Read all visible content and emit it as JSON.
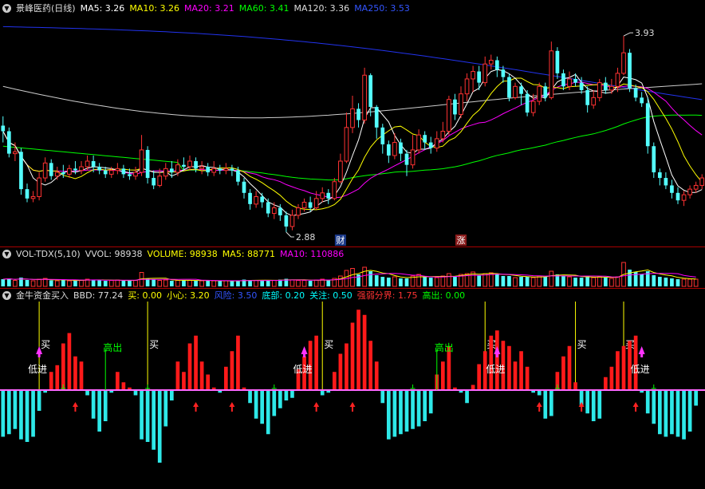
{
  "price_panel": {
    "title": "景峰医药(日线)",
    "ma_items": [
      {
        "text": "MA5: 3.26",
        "color": "#ffffff"
      },
      {
        "text": "MA10: 3.26",
        "color": "#ffff00"
      },
      {
        "text": "MA20: 3.21",
        "color": "#ff00ff"
      },
      {
        "text": "MA60: 3.41",
        "color": "#00ff00"
      },
      {
        "text": "MA120: 3.36",
        "color": "#dddddd"
      },
      {
        "text": "MA250: 3.53",
        "color": "#3355ff"
      }
    ],
    "high_label": "3.93",
    "low_label": "2.88",
    "badge_cai": "财",
    "badge_zhang": "涨"
  },
  "volume_panel": {
    "items": [
      {
        "text": "VOL-TDX(5,10)",
        "color": "#dddddd"
      },
      {
        "text": "VVOL: 98938",
        "color": "#dddddd"
      },
      {
        "text": "VOLUME: 98938",
        "color": "#ffff00"
      },
      {
        "text": "MA5: 88771",
        "color": "#ffff00"
      },
      {
        "text": "MA10: 110886",
        "color": "#ff00ff"
      }
    ]
  },
  "indicator_panel": {
    "items": [
      {
        "text": "金牛资金买入",
        "color": "#dddddd"
      },
      {
        "text": "BBD: 77.24",
        "color": "#dddddd"
      },
      {
        "text": "买: 0.00",
        "color": "#ffff00"
      },
      {
        "text": "小心: 3.20",
        "color": "#ffff00"
      },
      {
        "text": "风险: 3.50",
        "color": "#3355ff"
      },
      {
        "text": "底部: 0.20",
        "color": "#00ffff"
      },
      {
        "text": "关注: 0.50",
        "color": "#00ffff"
      },
      {
        "text": "强弱分界: 1.75",
        "color": "#ff3333"
      },
      {
        "text": "高出: 0.00",
        "color": "#00ff00"
      }
    ],
    "label_buy": "买",
    "label_low_in": "低进",
    "label_high_out": "高出"
  },
  "colors": {
    "up": "#ff3232",
    "down": "#54ffff",
    "ma5": "#ffffff",
    "ma10": "#ffff00",
    "ma20": "#ff00ff",
    "ma60": "#00ff00",
    "ma120": "#cccccc",
    "ma250": "#2233ee"
  },
  "chart_data": {
    "type": "candlestick",
    "y_range": [
      2.85,
      4.02
    ],
    "candles": [
      [
        3.45,
        3.42,
        3.5,
        3.36
      ],
      [
        3.42,
        3.3,
        3.44,
        3.28
      ],
      [
        3.3,
        3.31,
        3.36,
        3.26
      ],
      [
        3.31,
        3.11,
        3.33,
        3.08
      ],
      [
        3.11,
        3.06,
        3.14,
        3.04
      ],
      [
        3.06,
        3.07,
        3.1,
        3.04
      ],
      [
        3.07,
        3.17,
        3.2,
        3.05
      ],
      [
        3.17,
        3.25,
        3.28,
        3.15
      ],
      [
        3.25,
        3.18,
        3.27,
        3.16
      ],
      [
        3.18,
        3.2,
        3.23,
        3.16
      ],
      [
        3.2,
        3.19,
        3.24,
        3.17
      ],
      [
        3.19,
        3.22,
        3.24,
        3.17
      ],
      [
        3.22,
        3.21,
        3.26,
        3.19
      ],
      [
        3.21,
        3.23,
        3.26,
        3.19
      ],
      [
        3.23,
        3.26,
        3.29,
        3.21
      ],
      [
        3.26,
        3.23,
        3.29,
        3.2
      ],
      [
        3.23,
        3.21,
        3.25,
        3.19
      ],
      [
        3.21,
        3.19,
        3.23,
        3.17
      ],
      [
        3.19,
        3.21,
        3.23,
        3.17
      ],
      [
        3.21,
        3.22,
        3.25,
        3.19
      ],
      [
        3.22,
        3.19,
        3.24,
        3.17
      ],
      [
        3.19,
        3.18,
        3.22,
        3.16
      ],
      [
        3.18,
        3.2,
        3.23,
        3.16
      ],
      [
        3.2,
        3.32,
        3.4,
        3.18
      ],
      [
        3.32,
        3.17,
        3.34,
        3.14
      ],
      [
        3.17,
        3.13,
        3.21,
        3.11
      ],
      [
        3.13,
        3.18,
        3.22,
        3.12
      ],
      [
        3.18,
        3.22,
        3.25,
        3.16
      ],
      [
        3.22,
        3.2,
        3.26,
        3.17
      ],
      [
        3.2,
        3.24,
        3.27,
        3.18
      ],
      [
        3.24,
        3.23,
        3.28,
        3.21
      ],
      [
        3.23,
        3.26,
        3.29,
        3.21
      ],
      [
        3.26,
        3.22,
        3.28,
        3.2
      ],
      [
        3.22,
        3.23,
        3.26,
        3.19
      ],
      [
        3.23,
        3.2,
        3.25,
        3.18
      ],
      [
        3.2,
        3.22,
        3.26,
        3.18
      ],
      [
        3.22,
        3.21,
        3.24,
        3.19
      ],
      [
        3.21,
        3.22,
        3.25,
        3.19
      ],
      [
        3.22,
        3.21,
        3.24,
        3.18
      ],
      [
        3.21,
        3.15,
        3.23,
        3.13
      ],
      [
        3.15,
        3.09,
        3.17,
        3.06
      ],
      [
        3.09,
        3.03,
        3.11,
        3.0
      ],
      [
        3.03,
        3.07,
        3.1,
        3.01
      ],
      [
        3.07,
        3.04,
        3.09,
        3.01
      ],
      [
        3.04,
        2.98,
        3.06,
        2.96
      ],
      [
        2.98,
        3.01,
        3.04,
        2.95
      ],
      [
        3.01,
        2.97,
        3.03,
        2.94
      ],
      [
        2.97,
        2.91,
        2.99,
        2.88
      ],
      [
        2.91,
        2.97,
        3.0,
        2.89
      ],
      [
        2.97,
        3.01,
        3.03,
        2.95
      ],
      [
        3.01,
        3.04,
        3.06,
        2.99
      ],
      [
        3.04,
        3.01,
        3.07,
        2.99
      ],
      [
        3.01,
        3.06,
        3.1,
        3.0
      ],
      [
        3.06,
        3.09,
        3.12,
        3.04
      ],
      [
        3.09,
        3.06,
        3.11,
        3.03
      ],
      [
        3.06,
        3.15,
        3.17,
        3.05
      ],
      [
        3.15,
        3.26,
        3.3,
        3.14
      ],
      [
        3.26,
        3.44,
        3.52,
        3.25
      ],
      [
        3.44,
        3.54,
        3.61,
        3.41
      ],
      [
        3.54,
        3.48,
        3.57,
        3.44
      ],
      [
        3.48,
        3.72,
        3.76,
        3.46
      ],
      [
        3.72,
        3.55,
        3.73,
        3.5
      ],
      [
        3.55,
        3.44,
        3.56,
        3.38
      ],
      [
        3.44,
        3.35,
        3.46,
        3.3
      ],
      [
        3.35,
        3.29,
        3.37,
        3.25
      ],
      [
        3.29,
        3.36,
        3.41,
        3.27
      ],
      [
        3.36,
        3.3,
        3.38,
        3.26
      ],
      [
        3.3,
        3.24,
        3.32,
        3.18
      ],
      [
        3.24,
        3.32,
        3.4,
        3.22
      ],
      [
        3.32,
        3.4,
        3.43,
        3.3
      ],
      [
        3.4,
        3.36,
        3.42,
        3.32
      ],
      [
        3.36,
        3.33,
        3.39,
        3.3
      ],
      [
        3.33,
        3.38,
        3.42,
        3.31
      ],
      [
        3.38,
        3.42,
        3.47,
        3.36
      ],
      [
        3.42,
        3.59,
        3.61,
        3.4
      ],
      [
        3.59,
        3.51,
        3.62,
        3.48
      ],
      [
        3.51,
        3.62,
        3.66,
        3.49
      ],
      [
        3.62,
        3.7,
        3.73,
        3.58
      ],
      [
        3.7,
        3.74,
        3.77,
        3.63
      ],
      [
        3.74,
        3.68,
        3.77,
        3.64
      ],
      [
        3.68,
        3.78,
        3.82,
        3.66
      ],
      [
        3.78,
        3.8,
        3.83,
        3.75
      ],
      [
        3.8,
        3.75,
        3.82,
        3.71
      ],
      [
        3.75,
        3.71,
        3.77,
        3.68
      ],
      [
        3.71,
        3.6,
        3.73,
        3.58
      ],
      [
        3.6,
        3.66,
        3.68,
        3.59
      ],
      [
        3.66,
        3.62,
        3.68,
        3.56
      ],
      [
        3.62,
        3.52,
        3.64,
        3.5
      ],
      [
        3.52,
        3.58,
        3.62,
        3.5
      ],
      [
        3.58,
        3.66,
        3.68,
        3.56
      ],
      [
        3.66,
        3.6,
        3.68,
        3.58
      ],
      [
        3.6,
        3.85,
        3.9,
        3.59
      ],
      [
        3.85,
        3.73,
        3.87,
        3.7
      ],
      [
        3.73,
        3.66,
        3.75,
        3.64
      ],
      [
        3.66,
        3.7,
        3.74,
        3.64
      ],
      [
        3.7,
        3.68,
        3.73,
        3.66
      ],
      [
        3.68,
        3.64,
        3.71,
        3.62
      ],
      [
        3.64,
        3.56,
        3.66,
        3.52
      ],
      [
        3.56,
        3.6,
        3.64,
        3.54
      ],
      [
        3.6,
        3.68,
        3.7,
        3.58
      ],
      [
        3.68,
        3.64,
        3.71,
        3.62
      ],
      [
        3.64,
        3.66,
        3.7,
        3.62
      ],
      [
        3.66,
        3.73,
        3.76,
        3.63
      ],
      [
        3.73,
        3.84,
        3.93,
        3.72
      ],
      [
        3.84,
        3.65,
        3.86,
        3.63
      ],
      [
        3.65,
        3.6,
        3.67,
        3.58
      ],
      [
        3.6,
        3.57,
        3.63,
        3.55
      ],
      [
        3.57,
        3.34,
        3.6,
        3.3
      ],
      [
        3.34,
        3.2,
        3.36,
        3.17
      ],
      [
        3.2,
        3.17,
        3.22,
        3.13
      ],
      [
        3.17,
        3.13,
        3.2,
        3.11
      ],
      [
        3.13,
        3.09,
        3.16,
        3.06
      ],
      [
        3.09,
        3.05,
        3.12,
        3.03
      ],
      [
        3.05,
        3.08,
        3.1,
        3.02
      ],
      [
        3.08,
        3.11,
        3.13,
        3.06
      ],
      [
        3.11,
        3.13,
        3.15,
        3.09
      ],
      [
        3.13,
        3.17,
        3.19,
        3.11
      ]
    ],
    "volume": [
      18,
      20,
      15,
      22,
      16,
      14,
      18,
      20,
      15,
      14,
      16,
      14,
      15,
      16,
      18,
      17,
      15,
      14,
      15,
      16,
      15,
      14,
      15,
      35,
      20,
      17,
      15,
      16,
      14,
      15,
      16,
      15,
      14,
      14,
      15,
      14,
      13,
      14,
      13,
      15,
      17,
      16,
      15,
      14,
      16,
      15,
      17,
      19,
      16,
      15,
      15,
      14,
      16,
      18,
      15,
      20,
      26,
      40,
      45,
      30,
      48,
      38,
      28,
      24,
      22,
      24,
      20,
      20,
      26,
      30,
      24,
      22,
      22,
      26,
      32,
      26,
      30,
      32,
      36,
      28,
      32,
      34,
      30,
      26,
      26,
      22,
      24,
      24,
      22,
      26,
      24,
      38,
      30,
      26,
      24,
      22,
      22,
      26,
      22,
      24,
      22,
      20,
      24,
      60,
      42,
      36,
      30,
      38,
      28,
      24,
      22,
      20,
      18,
      18,
      18,
      18
    ],
    "indicator": [
      -0.9,
      -0.85,
      -0.75,
      -0.95,
      -1.0,
      -0.9,
      -0.4,
      -0.05,
      0.35,
      0.48,
      0.9,
      1.1,
      0.65,
      0.55,
      -0.1,
      -0.55,
      -0.8,
      -0.6,
      -0.05,
      0.35,
      0.15,
      0.05,
      -0.1,
      -0.95,
      -1.0,
      -1.15,
      -1.4,
      -0.7,
      -0.2,
      0.55,
      0.35,
      0.9,
      1.05,
      0.55,
      0.3,
      0.05,
      -0.05,
      0.45,
      0.75,
      1.05,
      0.05,
      -0.25,
      -0.55,
      -0.65,
      -0.85,
      -0.5,
      -0.35,
      -0.2,
      -0.15,
      0.4,
      0.65,
      0.95,
      1.05,
      -0.1,
      -0.05,
      0.35,
      0.7,
      0.9,
      1.3,
      1.55,
      1.45,
      0.95,
      0.55,
      -0.25,
      -0.95,
      -0.9,
      -0.85,
      -0.8,
      -0.75,
      -0.7,
      -0.6,
      -0.45,
      0.3,
      0.55,
      0.85,
      0.05,
      -0.05,
      -0.25,
      0.1,
      0.5,
      0.75,
      1.05,
      1.15,
      0.95,
      0.85,
      0.55,
      0.75,
      0.45,
      -0.05,
      -0.1,
      -0.55,
      -0.5,
      0.35,
      0.65,
      0.85,
      0.15,
      -0.3,
      -0.45,
      -0.6,
      -0.55,
      0.25,
      0.45,
      0.75,
      0.85,
      0.95,
      1.05,
      -0.05,
      -0.45,
      -0.65,
      -0.85,
      -0.9,
      -0.85,
      -0.9,
      -0.95,
      -0.8,
      -0.3
    ],
    "buy_signal_bars": [
      6,
      24,
      53,
      80,
      95,
      103
    ],
    "low_in_bars": [
      6,
      50,
      82,
      106,
      133
    ],
    "high_out_bars": [
      17,
      72
    ],
    "up_arrow_bars": [
      12,
      32,
      38,
      52,
      58,
      89,
      96,
      105,
      117,
      121
    ]
  }
}
